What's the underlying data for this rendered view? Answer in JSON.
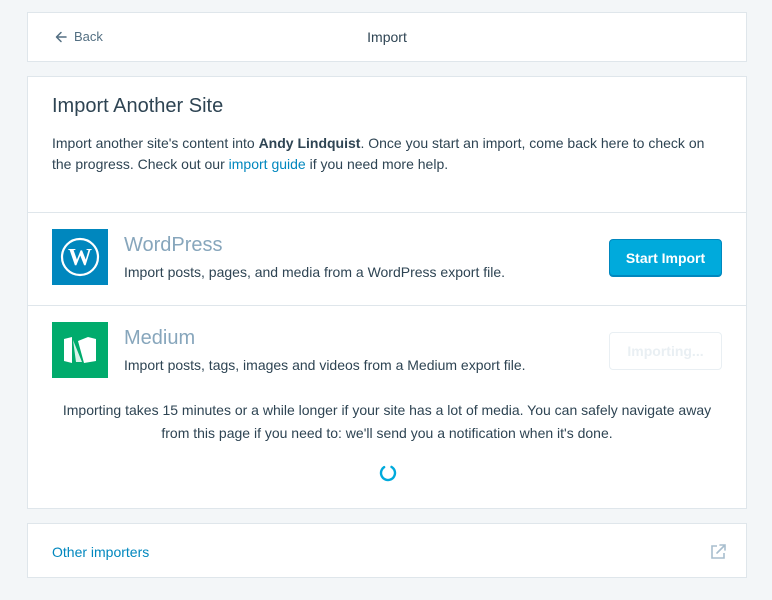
{
  "header": {
    "back_label": "Back",
    "title": "Import"
  },
  "main": {
    "heading": "Import Another Site",
    "intro_before": "Import another site's content into ",
    "site_name": "Andy Lindquist",
    "intro_middle": ". Once you start an import, come back here to check on the progress. Check out our ",
    "guide_link": "import guide",
    "intro_after": " if you need more help."
  },
  "importers": [
    {
      "name": "WordPress",
      "description": "Import posts, pages, and media from a WordPress export file.",
      "button_label": "Start Import",
      "icon": "wordpress-logo-icon",
      "color": "#0087be"
    },
    {
      "name": "Medium",
      "description": "Import posts, tags, images and videos from a Medium export file.",
      "button_label": "Importing...",
      "icon": "medium-logo-icon",
      "color": "#00ab6c"
    }
  ],
  "progress_note": "Importing takes 15 minutes or a while longer if your site has a lot of media. You can safely navigate away from this page if you need to: we'll send you a notification when it's done.",
  "other": {
    "label": "Other importers",
    "icon": "external-link-icon"
  },
  "colors": {
    "accent": "#0087be",
    "button": "#00aadc",
    "background": "#f3f6f8"
  }
}
